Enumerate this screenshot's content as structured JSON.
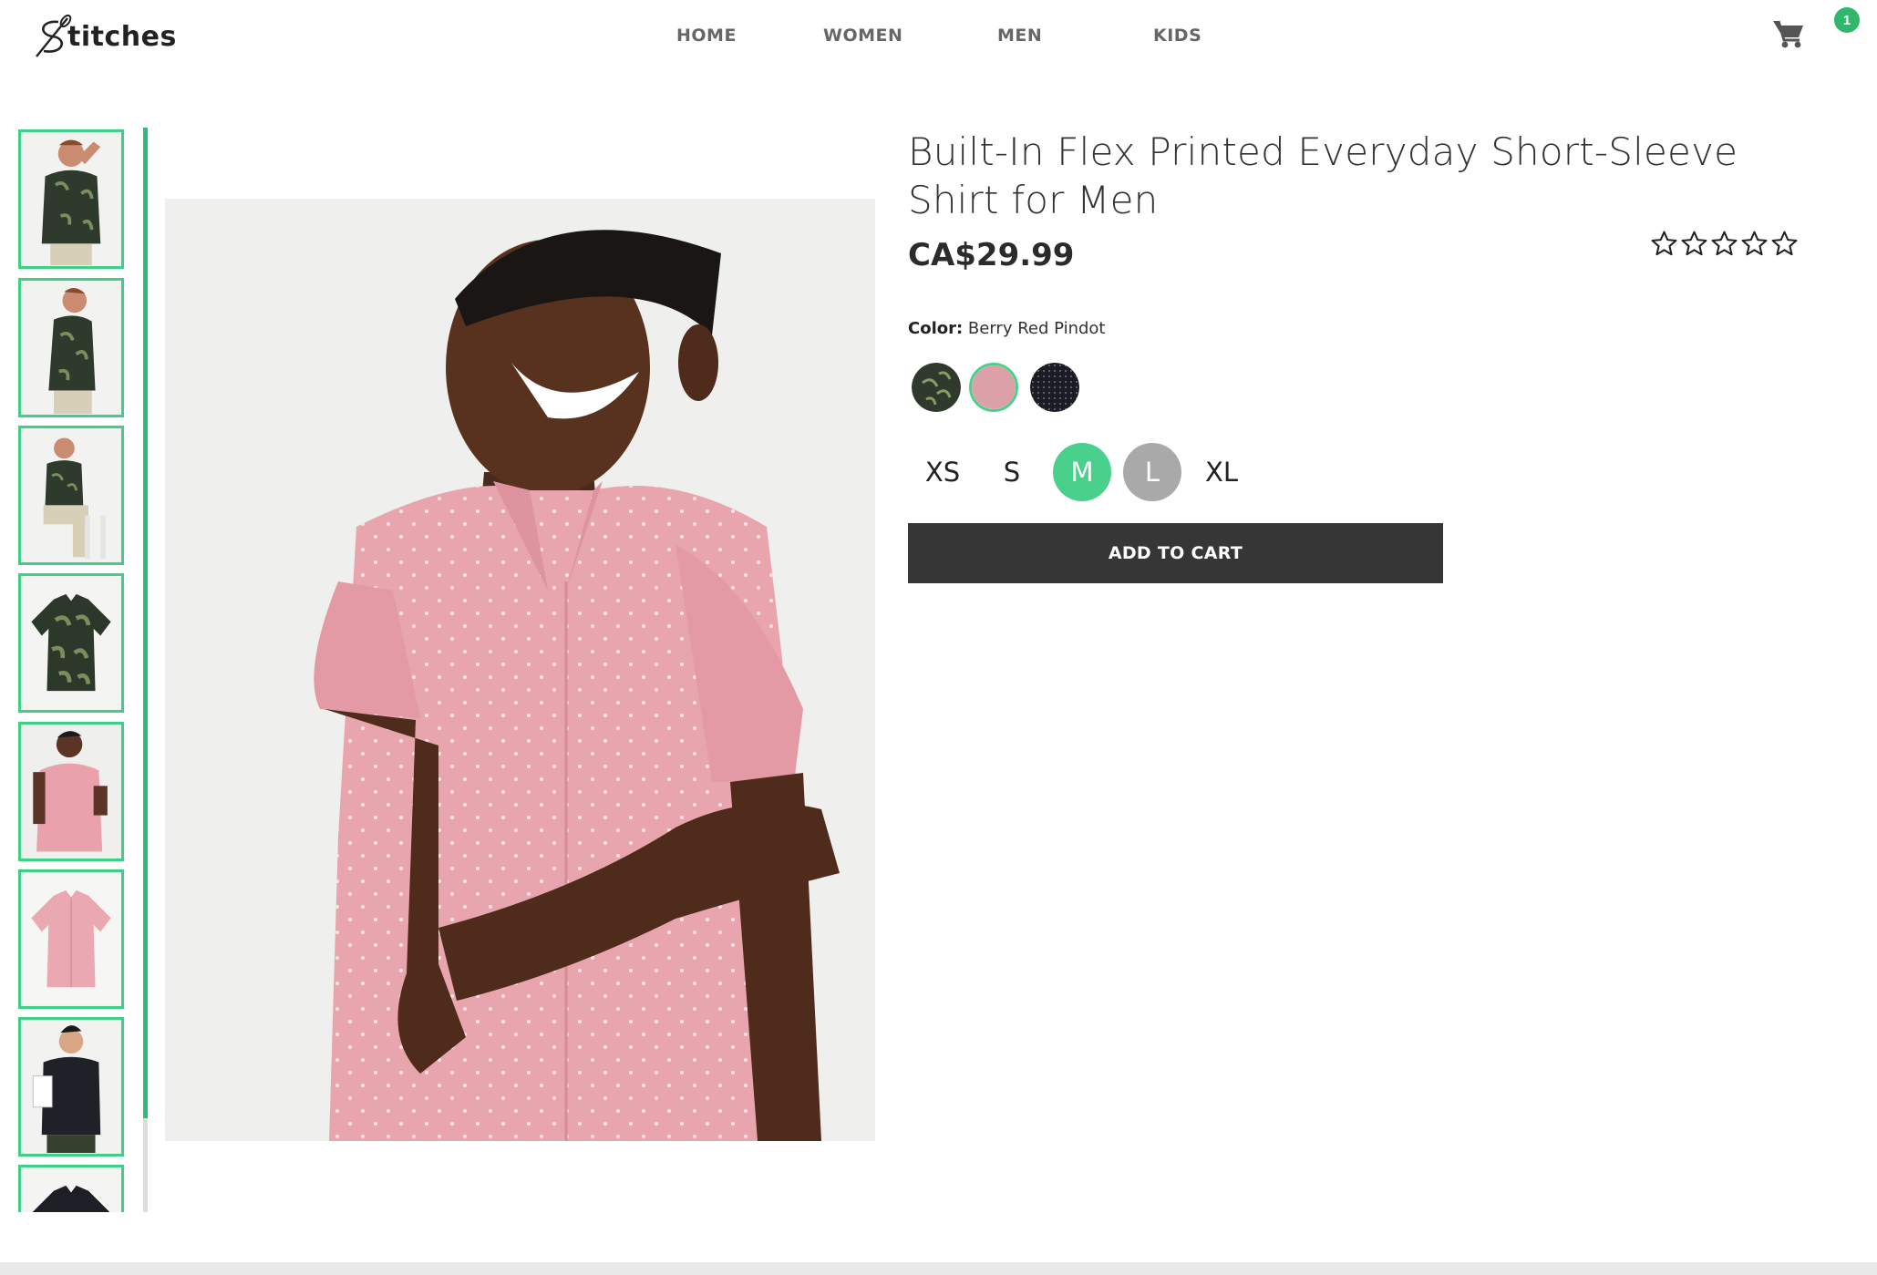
{
  "brand": {
    "name": "titches",
    "logo_mark": "needle-and-thread-s"
  },
  "nav": {
    "items": [
      "HOME",
      "WOMEN",
      "MEN",
      "KIDS"
    ]
  },
  "cart": {
    "icon": "shopping-cart-icon",
    "count": "1"
  },
  "product": {
    "title": "Built-In Flex Printed Everyday Short-Sleeve Shirt for Men",
    "price": "CA$29.99",
    "rating": {
      "filled": 0,
      "max": 5
    },
    "color_label": "Color:",
    "color_value": "Berry Red Pindot",
    "colors": [
      {
        "name": "Green Leaf Print",
        "hex": "#2f3a2c",
        "selected": false
      },
      {
        "name": "Berry Red Pindot",
        "hex": "#d99aa2",
        "selected": true
      },
      {
        "name": "Black Pindot",
        "hex": "#1c1d24",
        "selected": false
      }
    ],
    "sizes": [
      {
        "label": "XS",
        "state": "default"
      },
      {
        "label": "S",
        "state": "default"
      },
      {
        "label": "M",
        "state": "selected"
      },
      {
        "label": "L",
        "state": "unavailable"
      },
      {
        "label": "XL",
        "state": "default"
      }
    ],
    "add_to_cart_label": "ADD TO CART"
  },
  "gallery": {
    "thumbnails": [
      "model-green-leaf-front",
      "model-green-leaf-side",
      "model-green-leaf-seated",
      "shirt-green-leaf-flat",
      "model-pink-pindot",
      "shirt-pink-pindot-flat",
      "model-black-pindot",
      "shirt-black-pindot-flat"
    ],
    "main_image": "model-pink-pindot"
  },
  "colors": {
    "accent": "#3fcf86",
    "button": "#363636",
    "unavailable": "#a9a9a9"
  }
}
